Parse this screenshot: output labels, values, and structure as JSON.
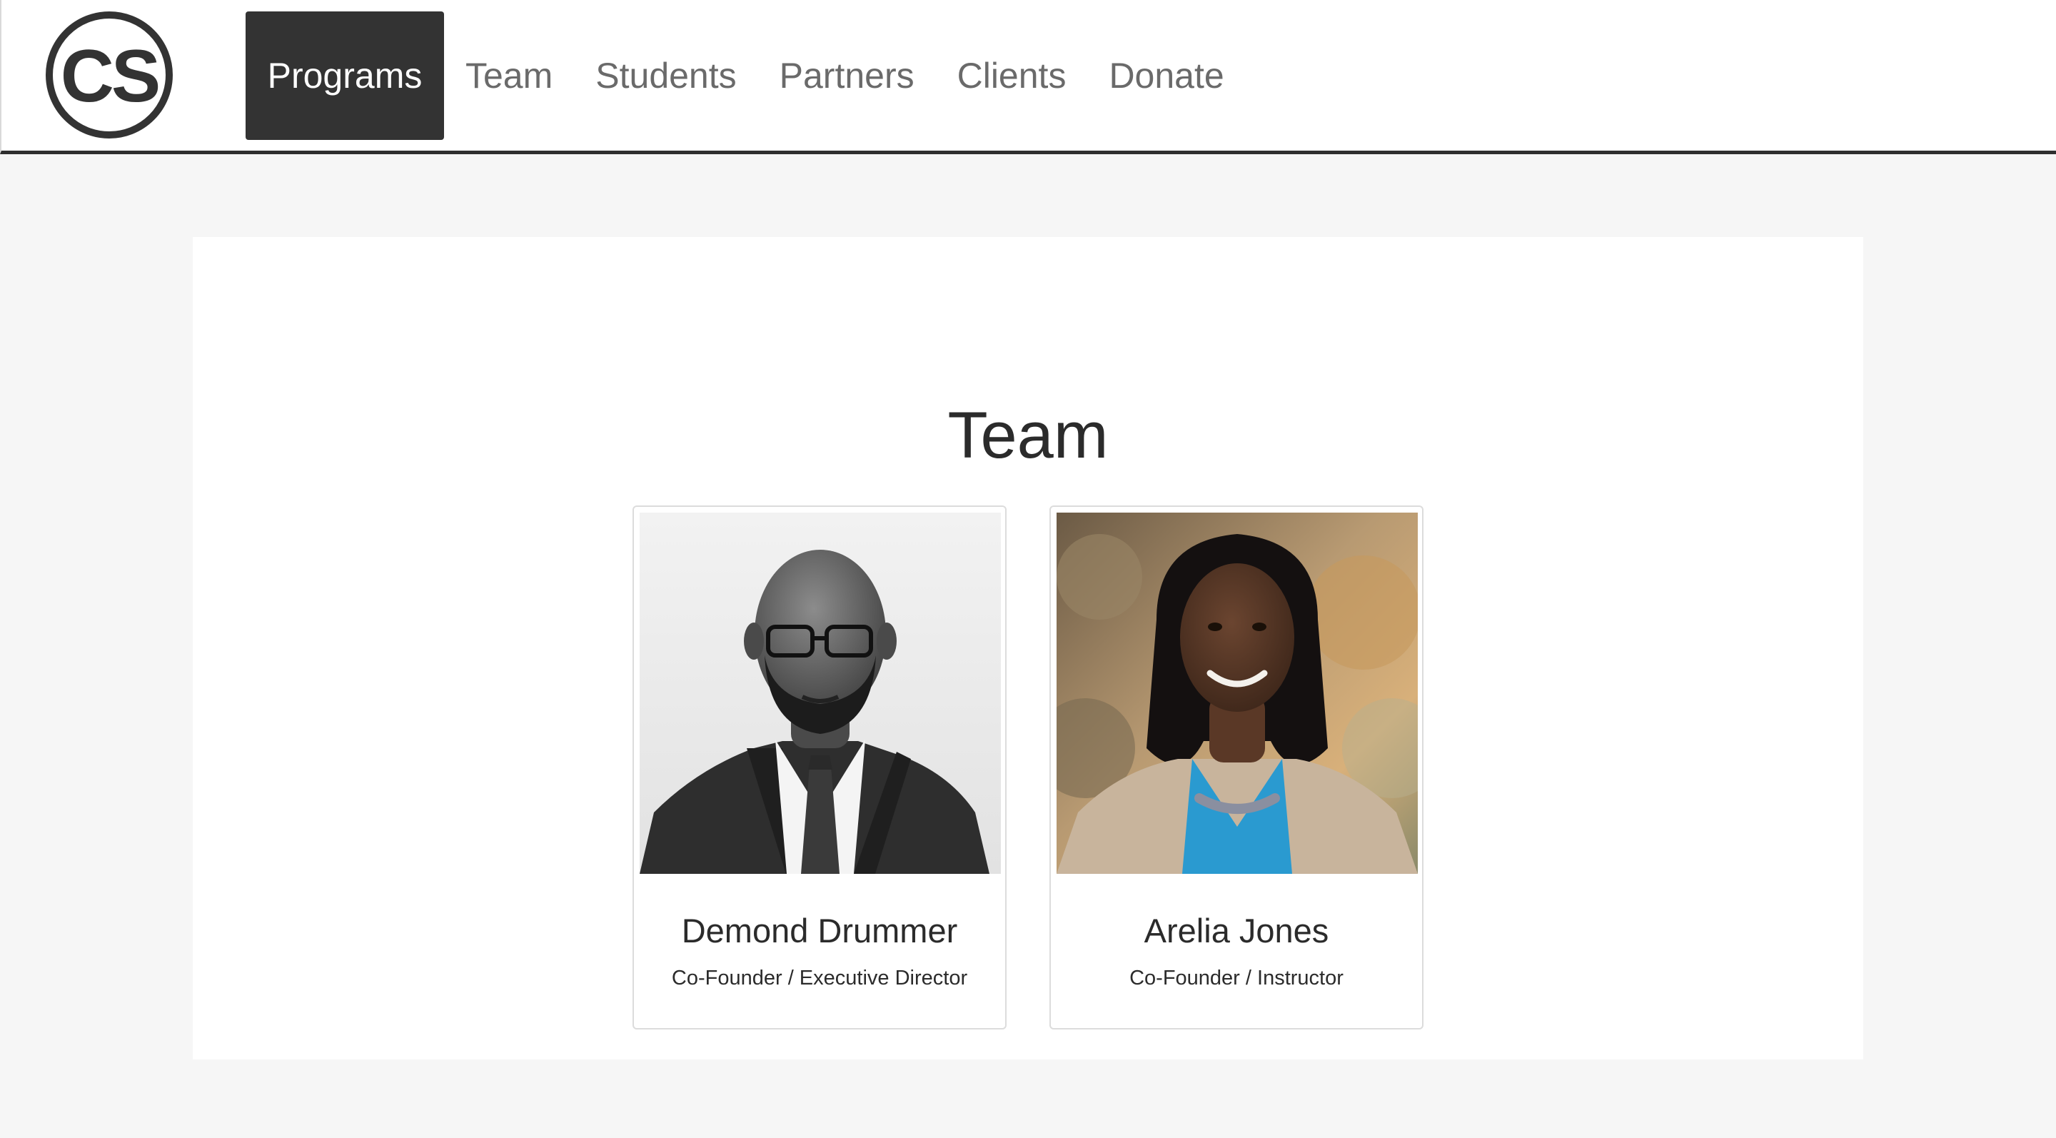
{
  "header": {
    "logo": {
      "text": "CS",
      "icon": "cs-logo-circle"
    },
    "nav": [
      {
        "label": "Programs",
        "active": true
      },
      {
        "label": "Team",
        "active": false
      },
      {
        "label": "Students",
        "active": false
      },
      {
        "label": "Partners",
        "active": false
      },
      {
        "label": "Clients",
        "active": false
      },
      {
        "label": "Donate",
        "active": false
      }
    ]
  },
  "main": {
    "title": "Team",
    "members": [
      {
        "name": "Demond Drummer",
        "role": "Co-Founder / Executive Director",
        "photo": "grayscale-portrait-man-suit"
      },
      {
        "name": "Arelia Jones",
        "role": "Co-Founder / Instructor",
        "photo": "color-portrait-woman-outdoors"
      }
    ]
  },
  "colors": {
    "page_bg": "#f6f6f6",
    "panel_bg": "#ffffff",
    "active_nav_bg": "#333333",
    "nav_text": "#6a6a6a",
    "text_dark": "#2b2b2b",
    "header_rule": "#2f2f2f"
  }
}
